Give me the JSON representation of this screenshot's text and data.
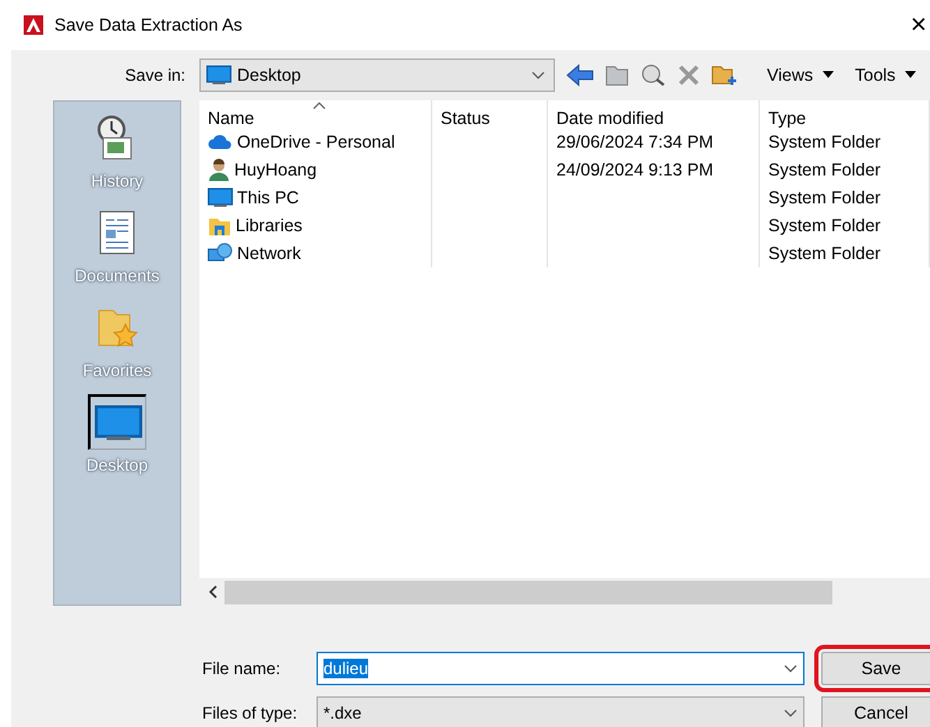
{
  "window": {
    "title": "Save Data Extraction As",
    "close": "×"
  },
  "toolbar": {
    "save_in_label": "Save in:",
    "location": "Desktop",
    "views": "Views",
    "tools": "Tools"
  },
  "sidebar": {
    "items": [
      {
        "label": "History",
        "kind": "history",
        "selected": false
      },
      {
        "label": "Documents",
        "kind": "documents",
        "selected": false
      },
      {
        "label": "Favorites",
        "kind": "favorites",
        "selected": false
      },
      {
        "label": "Desktop",
        "kind": "desktop",
        "selected": true
      }
    ]
  },
  "table": {
    "columns": [
      "Name",
      "Status",
      "Date modified",
      "Type"
    ],
    "rows": [
      {
        "kind": "cloud",
        "name": "OneDrive - Personal",
        "status": "",
        "date": "29/06/2024 7:34 PM",
        "type": "System Folder"
      },
      {
        "kind": "user",
        "name": "HuyHoang",
        "date": "24/09/2024 9:13 PM",
        "type": "System Folder"
      },
      {
        "kind": "pc",
        "name": "This PC",
        "type": "System Folder"
      },
      {
        "kind": "library",
        "name": "Libraries",
        "type": "System Folder"
      },
      {
        "kind": "network",
        "name": "Network",
        "type": "System Folder"
      }
    ]
  },
  "file_name": {
    "label": "File name:",
    "value": "dulieu"
  },
  "file_type": {
    "label": "Files of type:",
    "value": "*.dxe"
  },
  "buttons": [
    {
      "label": "Save",
      "highlighted": true
    },
    {
      "label": "Cancel",
      "highlighted": false
    }
  ]
}
